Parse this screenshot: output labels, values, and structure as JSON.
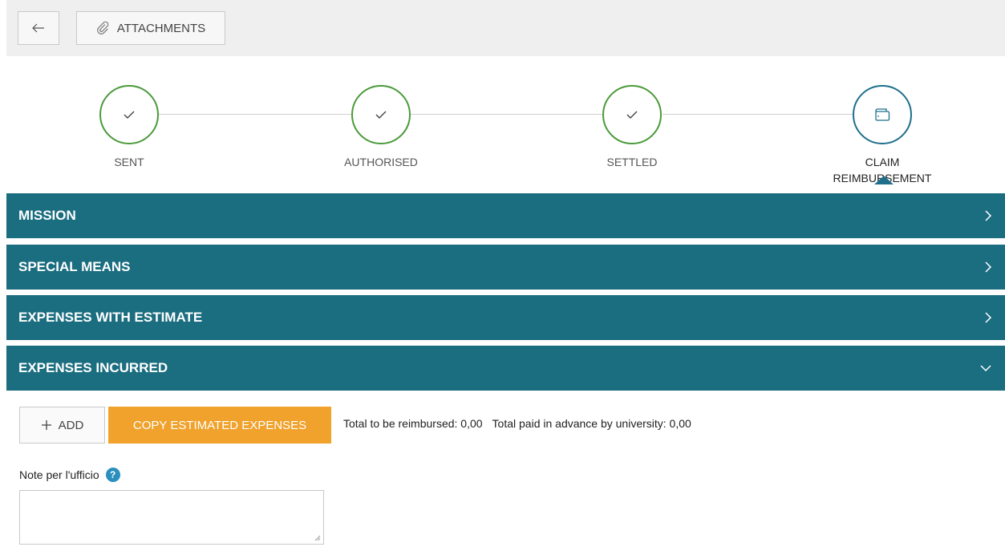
{
  "toolbar": {
    "back_icon": "arrow-left-icon",
    "attachments_icon": "paperclip-icon",
    "attachments_label": "ATTACHMENTS"
  },
  "steps": [
    {
      "label": "SENT",
      "status": "done",
      "icon": "check-icon"
    },
    {
      "label": "AUTHORISED",
      "status": "done",
      "icon": "check-icon"
    },
    {
      "label": "SETTLED",
      "status": "done",
      "icon": "check-icon"
    },
    {
      "label_line1": "CLAIM",
      "label_line2": "REIMBURSEMENT",
      "status": "current",
      "icon": "wallet-icon"
    }
  ],
  "panels": [
    {
      "title": "MISSION",
      "expanded": false
    },
    {
      "title": "SPECIAL MEANS",
      "expanded": false
    },
    {
      "title": "EXPENSES WITH ESTIMATE",
      "expanded": false
    },
    {
      "title": "EXPENSES INCURRED",
      "expanded": true
    }
  ],
  "expenses": {
    "add_label": "ADD",
    "copy_label": "COPY ESTIMATED EXPENSES",
    "total_reimbursed": "Total to be reimbursed: 0,00",
    "total_advance": "Total paid in advance by university: 0,00",
    "note_label": "Note per l'ufficio",
    "help_icon": "question-icon",
    "note_value": ""
  },
  "colors": {
    "panel_bg": "#1b6d80",
    "done_green": "#4a9a3a",
    "current_blue": "#1f6f8b",
    "copy_orange": "#f0a22c"
  }
}
